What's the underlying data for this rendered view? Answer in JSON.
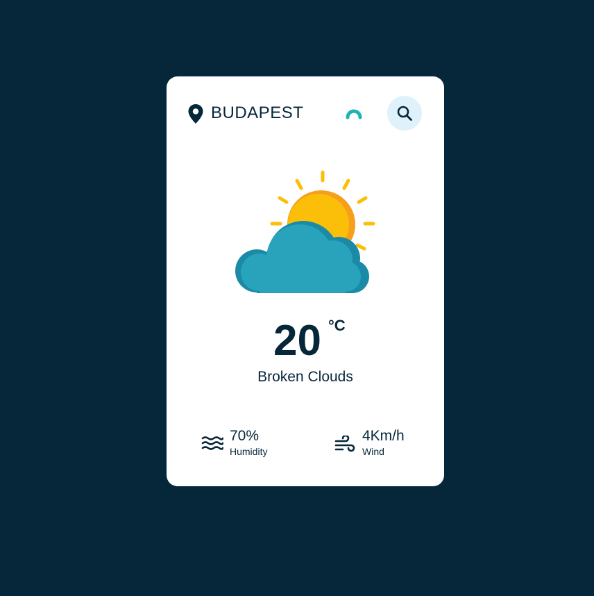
{
  "header": {
    "city": "BUDAPEST",
    "location_icon": "map-pin-icon",
    "loading_icon": "spinner-icon",
    "search_icon": "search-icon"
  },
  "weather": {
    "icon": "sun-behind-cloud-icon",
    "temperature": "20",
    "unit": "°C",
    "description": "Broken Clouds"
  },
  "stats": {
    "humidity": {
      "icon": "waves-icon",
      "value": "70%",
      "label": "Humidity"
    },
    "wind": {
      "icon": "wind-icon",
      "value": "4Km/h",
      "label": "Wind"
    }
  },
  "colors": {
    "background": "#06263a",
    "card": "#ffffff",
    "text": "#06263a",
    "search_button_bg": "#dff1fb",
    "sun": "#fbbf0a",
    "sun_shade": "#f59f1c",
    "cloud": "#29a3bc",
    "cloud_shade": "#1a8aa6",
    "spinner": "#1fb2b3"
  }
}
